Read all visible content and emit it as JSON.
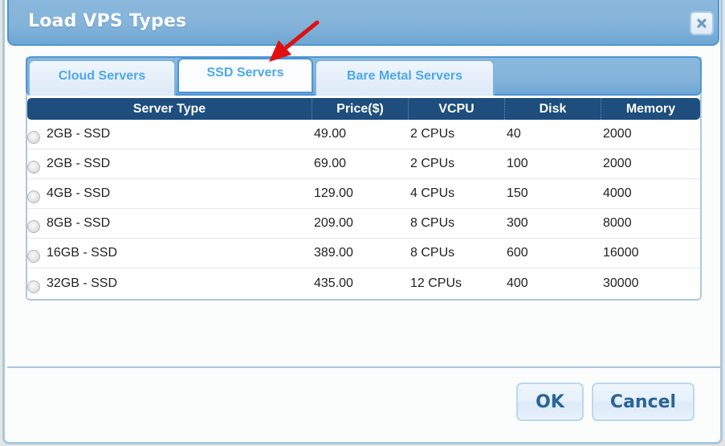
{
  "dialog": {
    "title": "Load VPS Types",
    "close_icon": "close-x-icon"
  },
  "tabs": [
    {
      "label": "Cloud Servers",
      "active": false
    },
    {
      "label": "SSD Servers",
      "active": true
    },
    {
      "label": "Bare Metal Servers",
      "active": false
    }
  ],
  "annotation": {
    "icon": "red-arrow-icon",
    "points_to": "SSD Servers"
  },
  "table": {
    "columns": [
      "Server Type",
      "Price($)",
      "VCPU",
      "Disk",
      "Memory"
    ],
    "rows": [
      {
        "type": "2GB - SSD",
        "price": "49.00",
        "vcpu": "2 CPUs",
        "disk": "40",
        "memory": "2000",
        "selected": false
      },
      {
        "type": "2GB - SSD",
        "price": "69.00",
        "vcpu": "2 CPUs",
        "disk": "100",
        "memory": "2000",
        "selected": false
      },
      {
        "type": "4GB - SSD",
        "price": "129.00",
        "vcpu": "4 CPUs",
        "disk": "150",
        "memory": "4000",
        "selected": false
      },
      {
        "type": "8GB - SSD",
        "price": "209.00",
        "vcpu": "8 CPUs",
        "disk": "300",
        "memory": "8000",
        "selected": false
      },
      {
        "type": "16GB - SSD",
        "price": "389.00",
        "vcpu": "8 CPUs",
        "disk": "600",
        "memory": "16000",
        "selected": false
      },
      {
        "type": "32GB - SSD",
        "price": "435.00",
        "vcpu": "12 CPUs",
        "disk": "400",
        "memory": "30000",
        "selected": false
      }
    ]
  },
  "footer": {
    "ok_label": "OK",
    "cancel_label": "Cancel"
  },
  "colors": {
    "titlebar": "#84b3da",
    "header_row": "#1d4e7e",
    "tab_text": "#4ca8ec",
    "button_text": "#2a6496",
    "arrow": "#e01010"
  }
}
